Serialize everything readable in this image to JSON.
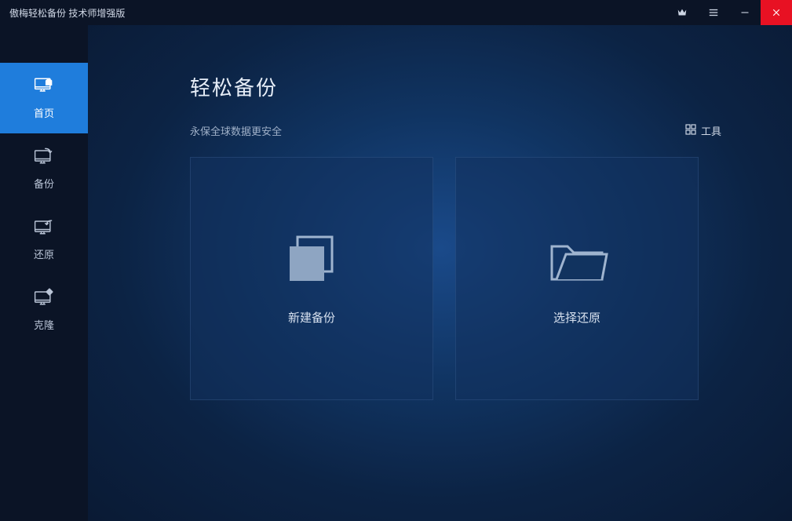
{
  "titlebar": {
    "title": "傲梅轻松备份 技术师增强版"
  },
  "sidebar": {
    "home": "首页",
    "backup": "备份",
    "restore": "还原",
    "clone": "克隆"
  },
  "main": {
    "title": "轻松备份",
    "subtitle": "永保全球数据更安全",
    "tools": "工具",
    "cards": {
      "new_backup": "新建备份",
      "select_restore": "选择还原"
    }
  }
}
